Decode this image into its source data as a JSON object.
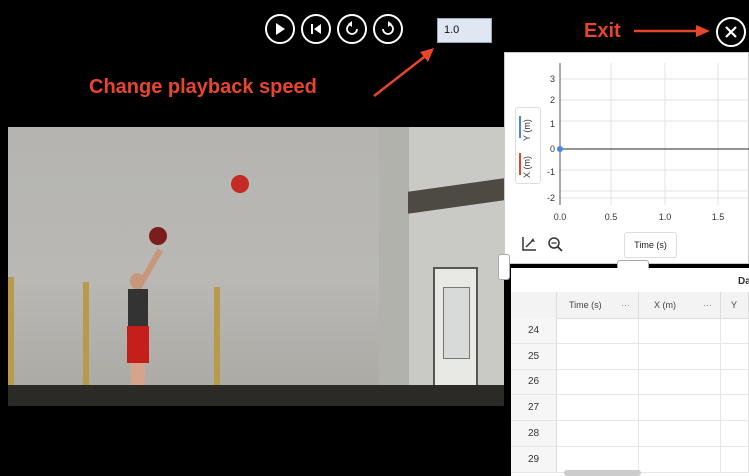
{
  "playback": {
    "speed_value": "1.0",
    "buttons": [
      "play",
      "rewind-to-start",
      "step-back",
      "step-forward"
    ]
  },
  "annotations": {
    "change_speed": "Change playback speed",
    "exit": "Exit"
  },
  "graph": {
    "y_ticks": [
      "3",
      "2",
      "1",
      "0",
      "-1",
      "-2"
    ],
    "x_ticks": [
      "0.0",
      "0.5",
      "1.0",
      "1.5"
    ],
    "legend_y": "Y (m)",
    "legend_x": "X (m)",
    "x_axis_button": "Time (s)",
    "y_color": "#4a86e8",
    "x_color": "#e8452c"
  },
  "table": {
    "title": "Data",
    "columns": [
      "Time (s)",
      "X (m)",
      "Y"
    ],
    "dots": "···",
    "rows": [
      "24",
      "25",
      "26",
      "27",
      "28",
      "29"
    ]
  },
  "icons": [
    "play-icon",
    "rewind-icon",
    "step-back-icon",
    "step-forward-icon",
    "close-icon",
    "autoscale-icon",
    "zoom-icon"
  ]
}
